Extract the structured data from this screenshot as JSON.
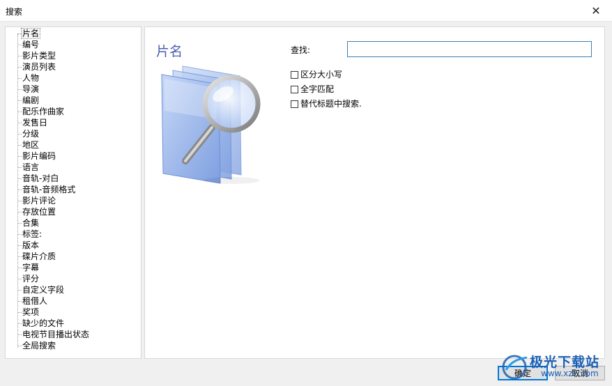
{
  "window": {
    "title": "搜索",
    "close_glyph": "✕"
  },
  "tree": {
    "items": [
      "片名",
      "编号",
      "影片类型",
      "演员列表",
      "人物",
      "导演",
      "编剧",
      "配乐作曲家",
      "发售日",
      "分级",
      "地区",
      "影片编码",
      "语言",
      "音轨-对白",
      "音轨-音频格式",
      "影片评论",
      "存放位置",
      "合集",
      "标签:",
      "版本",
      "碟片介质",
      "字幕",
      "评分",
      "自定义字段",
      "租借人",
      "奖项",
      "缺少的文件",
      "电视节目播出状态",
      "全局搜索"
    ],
    "selected_index": 0
  },
  "panel": {
    "heading": "片名",
    "find_label": "查找:",
    "find_value": "",
    "options": [
      {
        "label": "区分大小写",
        "checked": false
      },
      {
        "label": "全字匹配",
        "checked": false
      },
      {
        "label": "替代标题中搜索.",
        "checked": false
      }
    ]
  },
  "buttons": {
    "ok": "确定",
    "cancel": "取消"
  },
  "watermark": {
    "line1": "极光下载站",
    "line2": "www.xz7.com"
  },
  "colors": {
    "heading": "#4b5fb0",
    "input_border": "#3c7fb1",
    "ok_border": "#0078d7"
  }
}
